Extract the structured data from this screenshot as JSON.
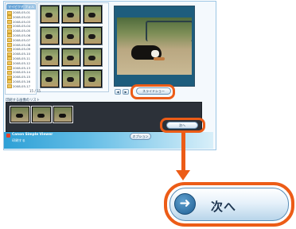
{
  "folder_pane": {
    "tabs": [
      "マイピクチャ",
      "フォルダ"
    ],
    "items": [
      "2008-05-01",
      "2008-05-02",
      "2008-05-03",
      "2008-05-04",
      "2008-05-05",
      "2008-05-06",
      "2008-05-07",
      "2008-05-08",
      "2008-05-09",
      "2008-05-10",
      "2008-05-11",
      "2008-05-12",
      "2008-05-13",
      "2008-05-14",
      "2008-05-15",
      "2008-05-16",
      "2008-05-17"
    ]
  },
  "thumbnail_area": {
    "count_text": "15 / 15"
  },
  "preview": {
    "prev_label": "◀",
    "next_label": "▶",
    "slideshow_label": "スライドショー"
  },
  "selection": {
    "label": "印刷する画像のリスト"
  },
  "footer": {
    "brand": "Canon Simple Viewer",
    "file_name": "印刷する"
  },
  "buttons": {
    "next_small_label": "次へ",
    "options_label": "オプション",
    "big_next_label": "次へ",
    "big_next_icon": "➜"
  },
  "colors": {
    "highlight": "#ec5c17",
    "footer_blue": "#2ea0d6"
  }
}
